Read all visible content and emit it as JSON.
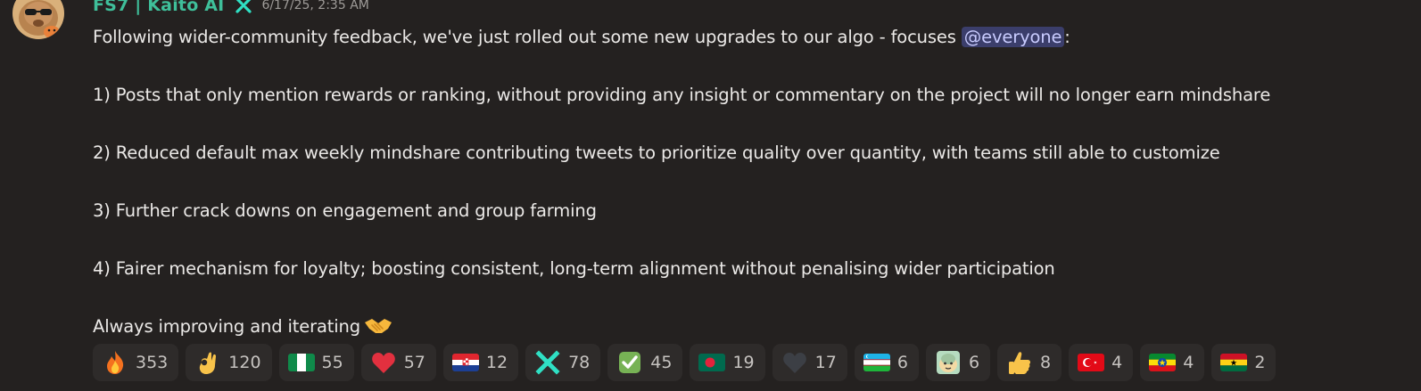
{
  "message": {
    "author": "FS7 | Kaito AI",
    "timestamp": "6/17/25, 2:35 AM",
    "intro_before": "Following wider-community feedback, we've just rolled out some new upgrades to our algo - focuses ",
    "mention": "@everyone",
    "intro_after": ":",
    "point1": "1) Posts that only mention rewards or ranking, without providing any insight or commentary on the project will no longer earn mindshare",
    "point2": "2) Reduced default max weekly mindshare contributing tweets to prioritize quality over quantity, with teams still able to customize",
    "point3": "3) Further crack downs on engagement and group farming",
    "point4": "4) Fairer mechanism for loyalty; boosting consistent, long-term alignment without penalising wider participation",
    "closing": "Always improving and iterating"
  },
  "reactions": [
    {
      "emoji": "fire-icon",
      "count": "353"
    },
    {
      "emoji": "ok-hand-icon",
      "count": "120"
    },
    {
      "emoji": "flag-nigeria-icon",
      "count": "55"
    },
    {
      "emoji": "red-heart-icon",
      "count": "57"
    },
    {
      "emoji": "flag-croatia-icon",
      "count": "12"
    },
    {
      "emoji": "kaito-x-icon",
      "count": "78"
    },
    {
      "emoji": "check-mark-icon",
      "count": "45"
    },
    {
      "emoji": "flag-bangladesh-icon",
      "count": "19"
    },
    {
      "emoji": "black-heart-icon",
      "count": "17"
    },
    {
      "emoji": "flag-uzbekistan-icon",
      "count": "6"
    },
    {
      "emoji": "custom-cat-icon",
      "count": "6"
    },
    {
      "emoji": "thumbs-up-icon",
      "count": "8"
    },
    {
      "emoji": "flag-turkey-icon",
      "count": "4"
    },
    {
      "emoji": "flag-ethiopia-icon",
      "count": "4"
    },
    {
      "emoji": "flag-ghana-icon",
      "count": "2"
    }
  ],
  "colors": {
    "background": "#242120",
    "username": "#3fbf9a",
    "mention_bg": "#3b3e6b",
    "reaction_bg": "#2e2b2a"
  }
}
